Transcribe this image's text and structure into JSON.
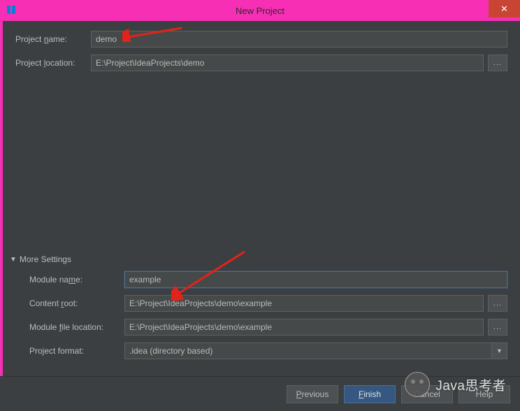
{
  "titlebar": {
    "title": "New Project",
    "close_symbol": "✕"
  },
  "fields": {
    "project_name_label_pre": "Project ",
    "project_name_label_u": "n",
    "project_name_label_post": "ame:",
    "project_name_value": "demo",
    "project_location_label_pre": "Project ",
    "project_location_label_u": "l",
    "project_location_label_post": "ocation:",
    "project_location_value": "E:\\Project\\IdeaProjects\\demo",
    "browse_symbol": "..."
  },
  "more_settings": {
    "label": "More Settings",
    "module_name_label_pre": "Module na",
    "module_name_label_u": "m",
    "module_name_label_post": "e:",
    "module_name_value": "example",
    "content_root_label_pre": "Content ",
    "content_root_label_u": "r",
    "content_root_label_post": "oot:",
    "content_root_value": "E:\\Project\\IdeaProjects\\demo\\example",
    "module_file_label_pre": "Module ",
    "module_file_label_u": "f",
    "module_file_label_post": "ile location:",
    "module_file_value": "E:\\Project\\IdeaProjects\\demo\\example",
    "project_format_label": "Project format:",
    "project_format_value": ".idea (directory based)"
  },
  "buttons": {
    "previous_u": "P",
    "previous_post": "revious",
    "finish_u": "F",
    "finish_post": "inish",
    "cancel": "Cancel",
    "help": "Help"
  },
  "watermark": {
    "text": "Java思考者"
  }
}
